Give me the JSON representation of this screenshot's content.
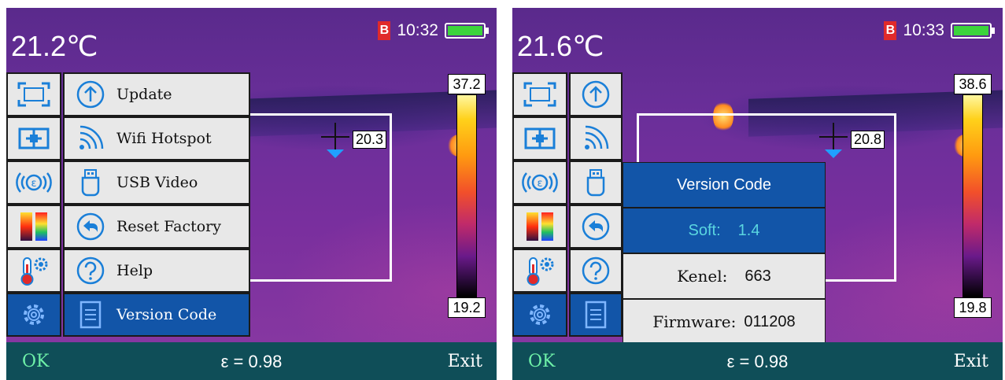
{
  "colors": {
    "menu_bg": "#e8e8e8",
    "active_bg": "#1255a8",
    "bottom_bar": "#0f4e58",
    "ok_text": "#6ef0a8",
    "soft_value": "#5ad6e0",
    "battery": "#3cd43c",
    "rec": "#e02a2a"
  },
  "left": {
    "temperature": "21.2℃",
    "time": "10:32",
    "rec_badge": "B",
    "spot_temp": "20.3",
    "scale_max": "37.2",
    "scale_min": "19.2",
    "sidebar_icons": [
      "roi-frame-icon",
      "center-spot-icon",
      "emissivity-icon",
      "palette-icon",
      "thermometer-settings-icon",
      "gear-icon"
    ],
    "menu": [
      {
        "icon": "upload-icon",
        "label": "Update"
      },
      {
        "icon": "wifi-icon",
        "label": "Wifi Hotspot"
      },
      {
        "icon": "usb-icon",
        "label": "USB Video"
      },
      {
        "icon": "reset-icon",
        "label": "Reset Factory"
      },
      {
        "icon": "help-icon",
        "label": "Help"
      },
      {
        "icon": "document-icon",
        "label": "Version Code"
      }
    ],
    "bottom": {
      "ok": "OK",
      "emissivity": "ε = 0.98",
      "exit": "Exit"
    }
  },
  "right": {
    "temperature": "21.6℃",
    "time": "10:33",
    "rec_badge": "B",
    "spot_temp": "20.8",
    "scale_max": "38.6",
    "scale_min": "19.8",
    "version_panel": {
      "title": "Version Code",
      "soft_key": "Soft:",
      "soft_value": "1.4",
      "kenel_key": "Kenel:",
      "kenel_value": "663",
      "firmware_key": "Firmware:",
      "firmware_value": "011208"
    },
    "bottom": {
      "ok": "OK",
      "emissivity": "ε = 0.98",
      "exit": "Exit"
    }
  }
}
